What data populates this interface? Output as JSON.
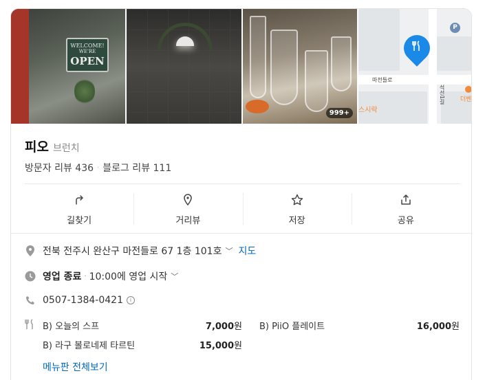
{
  "photos": {
    "sign_line1": "WELCOME!",
    "sign_line2": "WE'RE",
    "sign_line3": "OPEN",
    "photo_count": "999+",
    "map_street": "마전들로",
    "map_street2": "석선1길",
    "map_label1": "스시락",
    "map_label2": "더벤",
    "map_parking": "P"
  },
  "place": {
    "name": "피오",
    "category": "브런치",
    "visitor_reviews": "방문자 리뷰 436",
    "blog_reviews": "블로그 리뷰 111"
  },
  "actions": [
    {
      "label": "길찾기",
      "icon": "directions-icon"
    },
    {
      "label": "거리뷰",
      "icon": "street-view-icon"
    },
    {
      "label": "저장",
      "icon": "star-icon"
    },
    {
      "label": "공유",
      "icon": "share-icon"
    }
  ],
  "info": {
    "address": "전북 전주시 완산구 마전들로 67 1층 101호",
    "map_link": "지도",
    "status": "영업 종료",
    "hours": "10:00에 영업 시작",
    "phone": "0507-1384-0421"
  },
  "menu": {
    "items": [
      {
        "name": "B) 오늘의 스프",
        "price": "7,000",
        "unit": "원"
      },
      {
        "name": "B) PiiO 플레이트",
        "price": "16,000",
        "unit": "원"
      },
      {
        "name": "B) 라구 볼로네제 타르틴",
        "price": "15,000",
        "unit": "원"
      }
    ],
    "view_all": "메뉴판 전체보기"
  },
  "colors": {
    "link": "#0068c3",
    "pin": "#1b89e8"
  }
}
